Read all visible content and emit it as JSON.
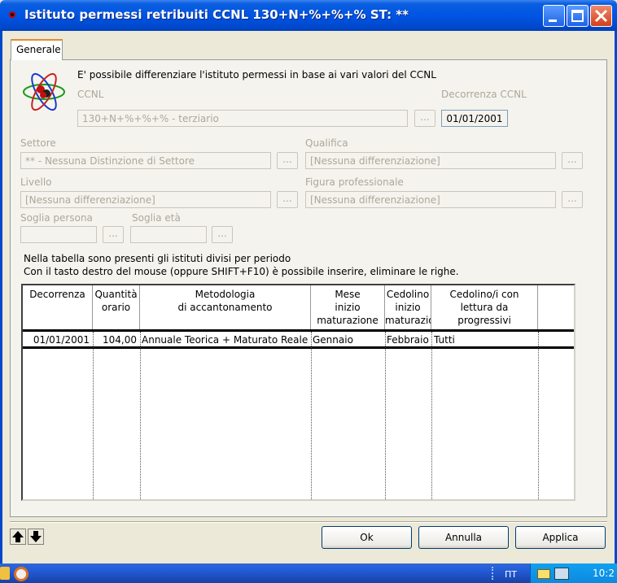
{
  "window": {
    "title": "Istituto permessi retribuiti  CCNL 130+N+%+%+% ST: **"
  },
  "tabs": [
    {
      "label": "Generale"
    }
  ],
  "intro": "E' possibile differenziare l'istituto permessi in base ai vari valori del CCNL",
  "fields": {
    "ccnl": {
      "label": "CCNL",
      "value": "130+N+%+%+% - terziario"
    },
    "decorrenza_ccnl": {
      "label": "Decorrenza CCNL",
      "value": "01/01/2001"
    },
    "settore": {
      "label": "Settore",
      "value": "** - Nessuna Distinzione di Settore"
    },
    "qualifica": {
      "label": "Qualifica",
      "value": "[Nessuna differenziazione]"
    },
    "livello": {
      "label": "Livello",
      "value": "[Nessuna differenziazione]"
    },
    "figura": {
      "label": "Figura professionale",
      "value": "[Nessuna differenziazione]"
    },
    "soglia_persona": {
      "label": "Soglia persona",
      "value": ""
    },
    "soglia_eta": {
      "label": "Soglia età",
      "value": ""
    },
    "ellipsis": "..."
  },
  "info": {
    "line1": "Nella tabella sono presenti gli istituti divisi per periodo",
    "line2": "Con il tasto destro del mouse (oppure SHIFT+F10) è possibile inserire, eliminare le righe."
  },
  "grid": {
    "columns": [
      {
        "key": "decorrenza",
        "label": "Decorrenza"
      },
      {
        "key": "quantita",
        "label": "Quantità\norario"
      },
      {
        "key": "metodologia",
        "label": "Metodologia\ndi accantonamento"
      },
      {
        "key": "mese",
        "label": "Mese\ninizio\nmaturazione"
      },
      {
        "key": "cedolino",
        "label": "Cedolino\ninizio\nmaturazio"
      },
      {
        "key": "progressivi",
        "label": "Cedolino/i con\nlettura da\nprogressivi"
      }
    ],
    "rows": [
      {
        "decorrenza": "01/01/2001",
        "quantita": "104,00",
        "metodologia": "Annuale Teorica + Maturato Reale",
        "mese": "Gennaio",
        "cedolino": "Febbraio",
        "progressivi": "Tutti"
      }
    ]
  },
  "buttons": {
    "ok": "Ok",
    "annulla": "Annulla",
    "applica": "Applica"
  },
  "taskbar": {
    "clock": "10:2"
  },
  "colors": {
    "titlebar": "#0054e3",
    "tab_accent": "#e68b2c",
    "window_bg": "#ece9d8"
  }
}
